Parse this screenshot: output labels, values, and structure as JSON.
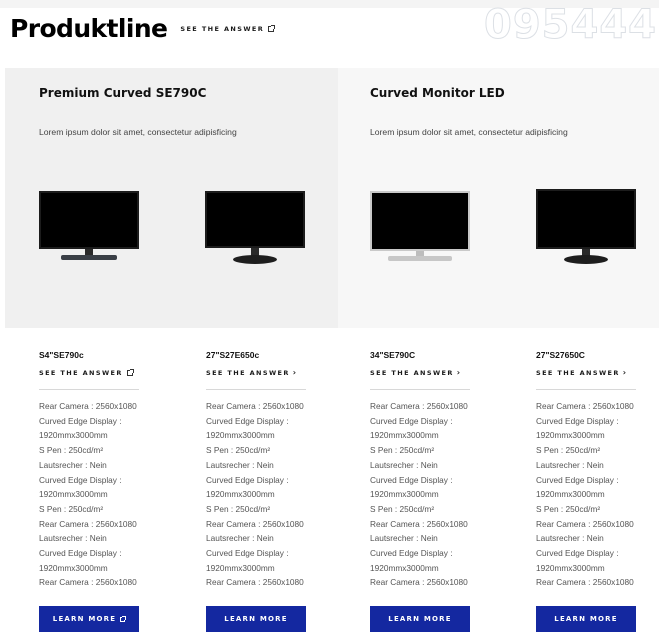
{
  "header": {
    "title": "Produktline",
    "see_answer": "SEE THE ANSWER",
    "watermark": "095444"
  },
  "heroes": [
    {
      "title": "Premium Curved SE790C",
      "desc": "Lorem ipsum dolor sit amet, consectetur adipisficing"
    },
    {
      "title": "Curved Monitor LED",
      "desc": "Lorem ipsum dolor sit amet, consectetur adipisficing"
    }
  ],
  "products": [
    {
      "model": "S4\"SE790c",
      "link": "SEE THE ANSWER",
      "link_icon": "external-link-icon",
      "specs": [
        "Rear Camera : 2560x1080",
        "Curved Edge Display :",
        "1920mmx3000mm",
        "S Pen : 250cd/m²",
        "Lautsrecher : Nein",
        "Curved Edge Display :",
        "1920mmx3000mm",
        "S Pen : 250cd/m²",
        "Rear Camera : 2560x1080",
        "Lautsrecher : Nein",
        "Curved Edge Display :",
        "1920mmx3000mm",
        "Rear Camera : 2560x1080"
      ],
      "button": "LEARN MORE",
      "button_icon": "external-link-icon"
    },
    {
      "model": "27\"S27E650c",
      "link": "SEE THE ANSWER",
      "link_icon": "chevron-right-icon",
      "specs": [
        "Rear Camera : 2560x1080",
        "Curved Edge Display :",
        "1920mmx3000mm",
        "S Pen : 250cd/m²",
        "Lautsrecher : Nein",
        "Curved Edge Display :",
        "1920mmx3000mm",
        "S Pen : 250cd/m²",
        "Rear Camera : 2560x1080",
        "Lautsrecher : Nein",
        "Curved Edge Display :",
        "1920mmx3000mm",
        "Rear Camera : 2560x1080"
      ],
      "button": "LEARN MORE"
    },
    {
      "model": "34\"SE790C",
      "link": "SEE THE ANSWER",
      "link_icon": "chevron-right-icon",
      "specs": [
        "Rear Camera : 2560x1080",
        "Curved Edge Display :",
        "1920mmx3000mm",
        "S Pen : 250cd/m²",
        "Lautsrecher : Nein",
        "Curved Edge Display :",
        "1920mmx3000mm",
        "S Pen : 250cd/m²",
        "Rear Camera : 2560x1080",
        "Lautsrecher : Nein",
        "Curved Edge Display :",
        "1920mmx3000mm",
        "Rear Camera : 2560x1080"
      ],
      "button": "LEARN MORE"
    },
    {
      "model": "27\"S27650C",
      "link": "SEE THE ANSWER",
      "link_icon": "chevron-right-icon",
      "specs": [
        "Rear Camera : 2560x1080",
        "Curved Edge Display :",
        "1920mmx3000mm",
        "S Pen : 250cd/m²",
        "Lautsrecher : Nein",
        "Curved Edge Display :",
        "1920mmx3000mm",
        "S Pen : 250cd/m²",
        "Rear Camera : 2560x1080",
        "Lautsrecher : Nein",
        "Curved Edge Display :",
        "1920mmx3000mm",
        "Rear Camera : 2560x1080"
      ],
      "button": "LEARN MORE"
    }
  ],
  "colors": {
    "button": "#1428a0",
    "hero_bg": "#f0f0f0"
  }
}
